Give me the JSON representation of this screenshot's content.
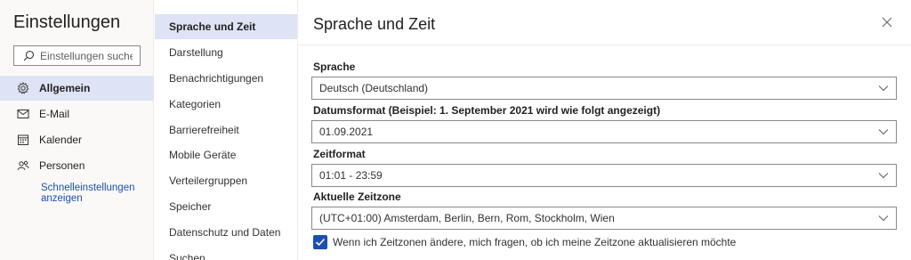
{
  "left": {
    "title": "Einstellungen",
    "search_placeholder": "Einstellungen suchen",
    "categories": [
      {
        "label": "Allgemein",
        "icon": "gear-icon",
        "active": true
      },
      {
        "label": "E-Mail",
        "icon": "mail-icon",
        "active": false
      },
      {
        "label": "Kalender",
        "icon": "calendar-icon",
        "active": false
      },
      {
        "label": "Personen",
        "icon": "people-icon",
        "active": false
      }
    ],
    "quick_settings_link": "Schnelleinstellungen anzeigen"
  },
  "nav": {
    "items": [
      {
        "label": "Sprache und Zeit",
        "active": true
      },
      {
        "label": "Darstellung",
        "active": false
      },
      {
        "label": "Benachrichtigungen",
        "active": false
      },
      {
        "label": "Kategorien",
        "active": false
      },
      {
        "label": "Barrierefreiheit",
        "active": false
      },
      {
        "label": "Mobile Geräte",
        "active": false
      },
      {
        "label": "Verteilergruppen",
        "active": false
      },
      {
        "label": "Speicher",
        "active": false
      },
      {
        "label": "Datenschutz und Daten",
        "active": false
      },
      {
        "label": "Suchen",
        "active": false
      }
    ]
  },
  "main": {
    "title": "Sprache und Zeit",
    "fields": {
      "language": {
        "label": "Sprache",
        "value": "Deutsch (Deutschland)"
      },
      "date_format": {
        "label": "Datumsformat (Beispiel: 1. September 2021 wird wie folgt angezeigt)",
        "value": "01.09.2021"
      },
      "time_format": {
        "label": "Zeitformat",
        "value": "01:01 - 23:59"
      },
      "timezone": {
        "label": "Aktuelle Zeitzone",
        "value": "(UTC+01:00) Amsterdam, Berlin, Bern, Rom, Stockholm, Wien"
      }
    },
    "ask_timezone_checkbox": {
      "label": "Wenn ich Zeitzonen ändere, mich fragen, ob ich meine Zeitzone aktualisieren möchte",
      "checked": true
    }
  },
  "colors": {
    "accent": "#1b4fb0",
    "selected_bg": "#dee3f5",
    "panel_bg": "#faf9f8"
  }
}
